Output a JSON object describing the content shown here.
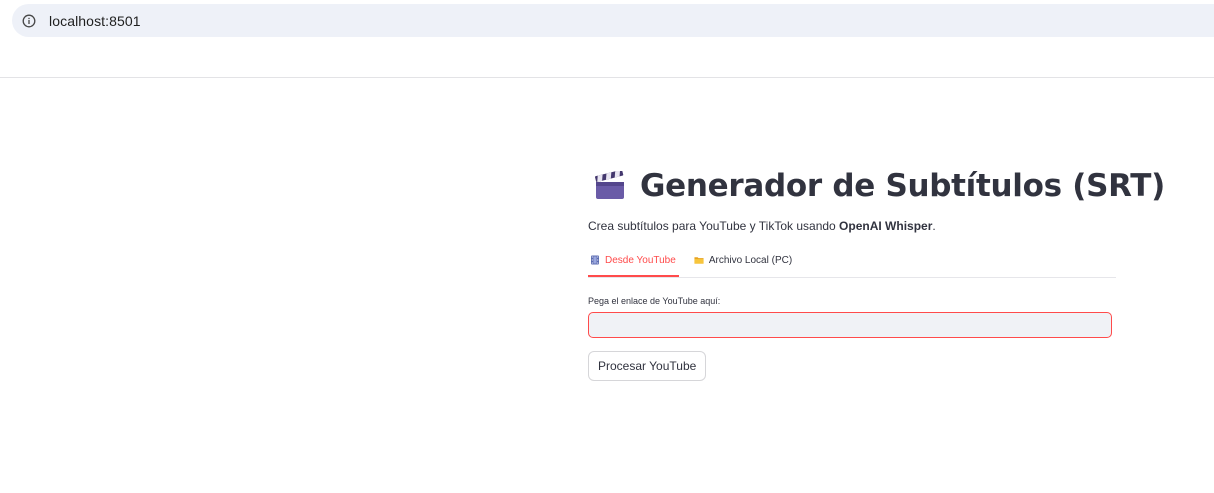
{
  "browser": {
    "url": "localhost:8501",
    "info_icon": "info-icon"
  },
  "main": {
    "title_icon": "clapper-board-icon",
    "title": "Generador de Subtítulos (SRT)",
    "subtitle_prefix": "Crea subtítulos para YouTube y TikTok usando ",
    "subtitle_bold": "OpenAI Whisper",
    "subtitle_suffix": ".",
    "tabs": [
      {
        "label": "Desde YouTube",
        "icon": "film-frames-icon",
        "active": true
      },
      {
        "label": "Archivo Local (PC)",
        "icon": "folder-icon",
        "active": false
      }
    ],
    "youtube_input": {
      "label": "Pega el enlace de YouTube aquí:",
      "value": "",
      "placeholder": ""
    },
    "process_button_label": "Procesar YouTube"
  },
  "colors": {
    "accent": "#ff4b4b",
    "text": "#31333f",
    "input_bg": "#f0f2f6",
    "address_bar_bg": "#eef1f8"
  }
}
